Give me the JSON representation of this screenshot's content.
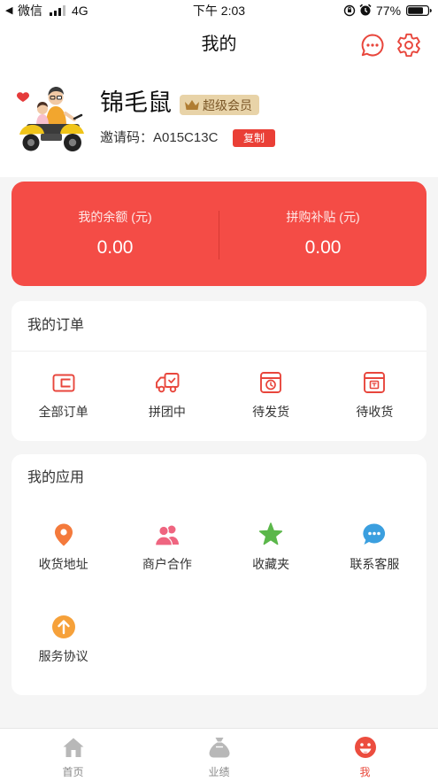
{
  "status_bar": {
    "back_arrow": "◀",
    "back_app": "微信",
    "network": "4G",
    "time": "下午 2:03",
    "battery": "77%",
    "battery_level": 0.77
  },
  "header": {
    "title": "我的",
    "icons": [
      "message-icon",
      "settings-gear-icon"
    ]
  },
  "profile": {
    "name": "锦毛鼠",
    "badge": "超级会员",
    "invite_label": "邀请码：",
    "invite_code": "A015C13C",
    "copy_button": "复制"
  },
  "balance_card": {
    "items": [
      {
        "label": "我的余额 (元)",
        "value": "0.00"
      },
      {
        "label": "拼购补贴 (元)",
        "value": "0.00"
      }
    ]
  },
  "orders": {
    "title": "我的订单",
    "items": [
      {
        "label": "全部订单",
        "icon": "wallet-icon"
      },
      {
        "label": "拼团中",
        "icon": "truck-icon"
      },
      {
        "label": "待发货",
        "icon": "box-clock-icon"
      },
      {
        "label": "待收货",
        "icon": "package-icon"
      }
    ]
  },
  "apps": {
    "title": "我的应用",
    "items": [
      {
        "label": "收货地址",
        "icon": "location-pin-icon"
      },
      {
        "label": "商户合作",
        "icon": "users-icon"
      },
      {
        "label": "收藏夹",
        "icon": "star-icon"
      },
      {
        "label": "联系客服",
        "icon": "chat-bubble-icon"
      },
      {
        "label": "服务协议",
        "icon": "arrow-up-circle-icon"
      }
    ]
  },
  "tab_bar": {
    "items": [
      {
        "label": "首页",
        "icon": "home-icon",
        "active": false
      },
      {
        "label": "业绩",
        "icon": "money-bag-icon",
        "active": false
      },
      {
        "label": "我",
        "icon": "smiley-icon",
        "active": true
      }
    ]
  },
  "colors": {
    "accent": "#e8463c",
    "balance_card": "#f44c46",
    "badge_bg": "#e8d3a8",
    "page_bg": "#f5f5f5",
    "pin": "#f47a3c",
    "users": "#ef6580",
    "star": "#5bb74a",
    "chat": "#3b9fdf",
    "agreement": "#f6a13a",
    "tab_inactive": "#b8b8b8"
  }
}
